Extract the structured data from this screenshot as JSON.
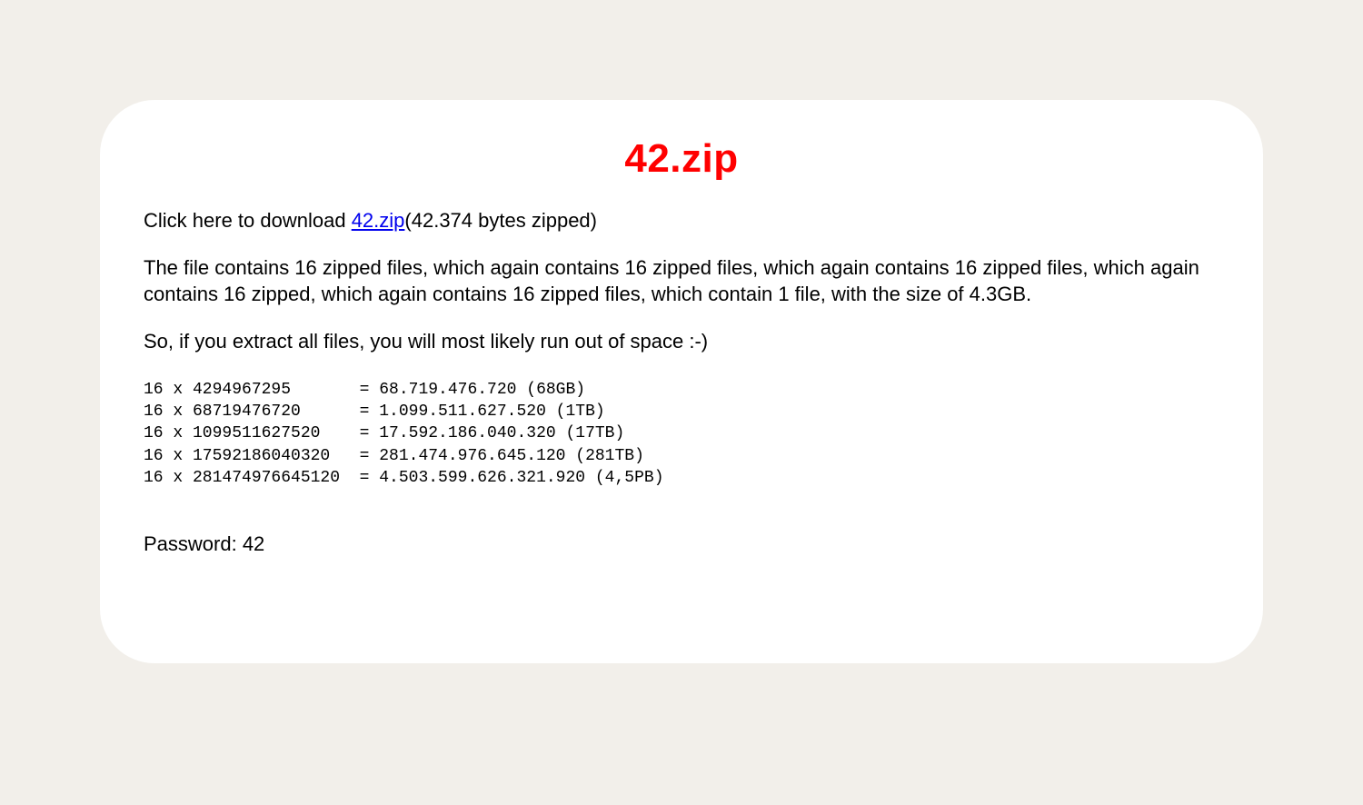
{
  "title": "42.zip",
  "intro": {
    "prefix": "Click here to download ",
    "link_text": "42.zip",
    "suffix": "(42.374 bytes zipped)"
  },
  "description": "The file contains 16 zipped files, which again contains 16 zipped files, which again contains 16 zipped files, which again contains 16 zipped, which again contains 16 zipped files, which contain 1 file, with the size of 4.3GB.",
  "warning": "So, if you extract all files, you will most likely run out of space :-)",
  "calc_lines": [
    "16 x 4294967295       = 68.719.476.720 (68GB)",
    "16 x 68719476720      = 1.099.511.627.520 (1TB)",
    "16 x 1099511627520    = 17.592.186.040.320 (17TB)",
    "16 x 17592186040320   = 281.474.976.645.120 (281TB)",
    "16 x 281474976645120  = 4.503.599.626.321.920 (4,5PB)"
  ],
  "password_line": "Password: 42"
}
